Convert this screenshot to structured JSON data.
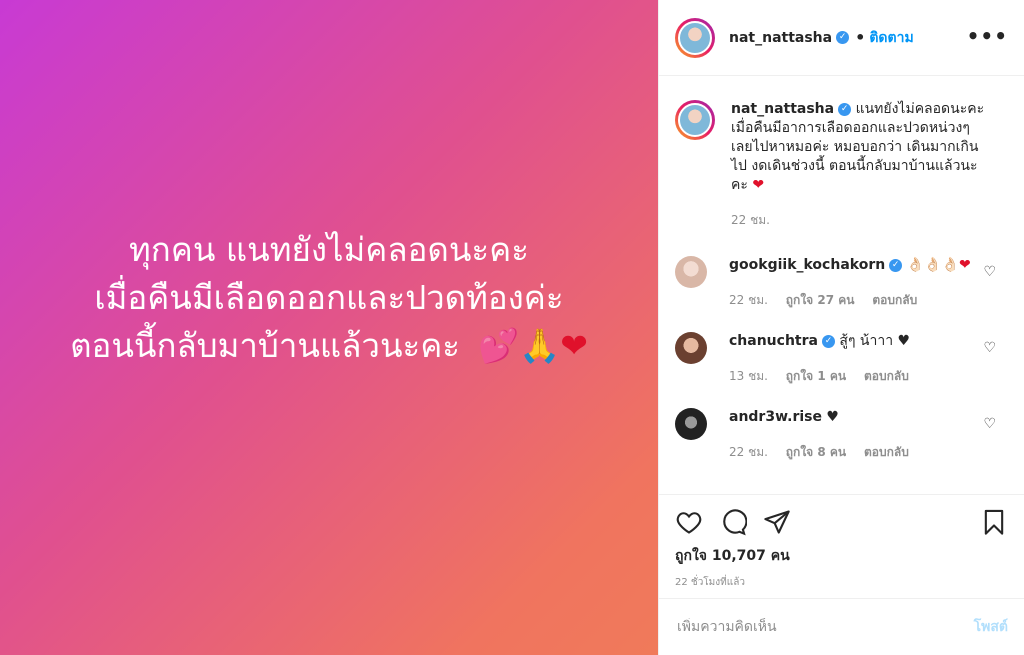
{
  "image": {
    "lines": [
      "ทุกคน  แนทยังไม่คลอดนะคะ",
      "เมื่อคืนมีเลือดออกและปวดท้องค่ะ",
      "ตอนนี้กลับมาบ้านแล้วนะคะ"
    ],
    "emojis": [
      "💕",
      "🙏",
      "❤"
    ]
  },
  "header": {
    "username": "nat_nattasha",
    "dot": "•",
    "follow_label": "ติดตาม",
    "more": "•••"
  },
  "caption": {
    "username": "nat_nattasha",
    "text": "แนทยังไม่คลอดนะคะ เมื่อคืนมีอาการเลือดออกและปวดหน่วงๆ เลยไปหาหมอค่ะ หมอบอกว่า เดินมากเกินไป งดเดินช่วงนี้ ตอนนี้กลับมาบ้านแล้วนะคะ",
    "emoji": "❤",
    "time": "22 ชม."
  },
  "comments": [
    {
      "username": "gookgiik_kochakorn",
      "text": "👌🏻👌🏻👌🏻",
      "emoji": "❤",
      "time": "22 ชม.",
      "likes": "ถูกใจ 27 คน",
      "reply": "ตอบกลับ",
      "avatar_color": "#e8cfc4"
    },
    {
      "username": "chanuchtra",
      "text": "สู้ๆ น้าาา ♥",
      "emoji": "",
      "time": "13 ชม.",
      "likes": "ถูกใจ 1 คน",
      "reply": "ตอบกลับ",
      "avatar_color": "#b07a5a"
    },
    {
      "username": "andr3w.rise",
      "text": "♥",
      "emoji": "",
      "time": "22 ชม.",
      "likes": "ถูกใจ 8 คน",
      "reply": "ตอบกลับ",
      "avatar_color": "#2f2f2f"
    }
  ],
  "actions": {
    "likes": "ถูกใจ 10,707 คน",
    "time": "22 ชั่วโมงที่แล้ว"
  },
  "comment_box": {
    "placeholder": "เพิ่มความคิดเห็น",
    "post_label": "โพสต์"
  }
}
